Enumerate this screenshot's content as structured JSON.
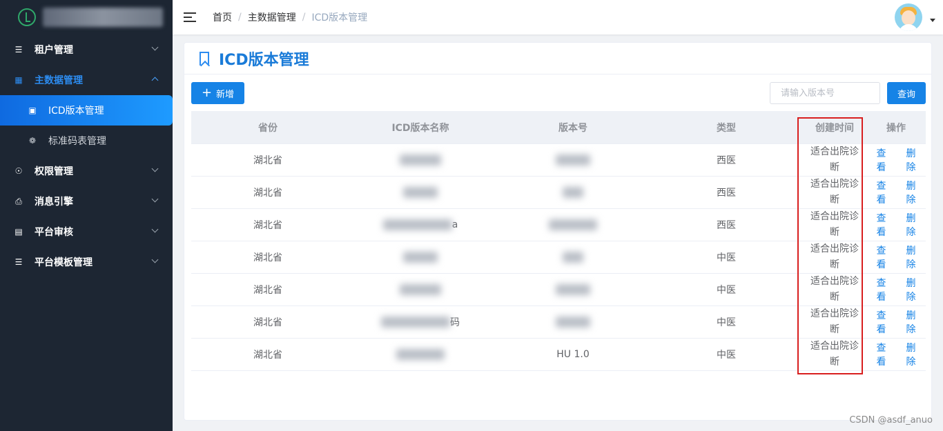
{
  "sidebar": {
    "items": [
      {
        "label": "租户管理",
        "icon": "layers-icon",
        "expanded": false
      },
      {
        "label": "主数据管理",
        "icon": "grid-icon",
        "expanded": true,
        "children": [
          {
            "label": "ICD版本管理",
            "icon": "monitor-icon",
            "selected": true
          },
          {
            "label": "标准码表管理",
            "icon": "gear-icon",
            "selected": false
          }
        ]
      },
      {
        "label": "权限管理",
        "icon": "shield-icon",
        "expanded": false
      },
      {
        "label": "消息引擎",
        "icon": "printer-icon",
        "expanded": false
      },
      {
        "label": "平台审核",
        "icon": "document-icon",
        "expanded": false
      },
      {
        "label": "平台模板管理",
        "icon": "layers-icon",
        "expanded": false
      }
    ]
  },
  "header": {
    "breadcrumb": [
      "首页",
      "主数据管理",
      "ICD版本管理"
    ],
    "separator": "/"
  },
  "page": {
    "title": "ICD版本管理",
    "add_button": "新增",
    "add_symbol": "+",
    "search_placeholder": "请输入版本号",
    "query_button": "查询"
  },
  "table": {
    "columns": [
      "省份",
      "ICD版本名称",
      "版本号",
      "类型",
      "创建时间",
      "操作"
    ],
    "rows": [
      {
        "province": "湖北省",
        "name_visible": "",
        "version_visible": "",
        "type": "西医",
        "created": "适合出院诊断"
      },
      {
        "province": "湖北省",
        "name_visible": "",
        "version_visible": "",
        "type": "西医",
        "created": "适合出院诊断"
      },
      {
        "province": "湖北省",
        "name_visible": "a",
        "version_visible": "",
        "type": "西医",
        "created": "适合出院诊断"
      },
      {
        "province": "湖北省",
        "name_visible": "",
        "version_visible": "",
        "type": "中医",
        "created": "适合出院诊断"
      },
      {
        "province": "湖北省",
        "name_visible": "",
        "version_visible": "",
        "type": "中医",
        "created": "适合出院诊断"
      },
      {
        "province": "湖北省",
        "name_visible": "码",
        "version_visible": "",
        "type": "中医",
        "created": "适合出院诊断"
      },
      {
        "province": "湖北省",
        "name_visible": "",
        "version_visible": "HU 1.0",
        "type": "中医",
        "created": "适合出院诊断"
      }
    ],
    "actions": {
      "view": "查看",
      "delete": "删除"
    }
  },
  "colors": {
    "sidebar_bg": "#1d2633",
    "accent": "#1683e6",
    "highlight_box": "#d81e1e"
  },
  "watermark": "CSDN @asdf_anuo"
}
